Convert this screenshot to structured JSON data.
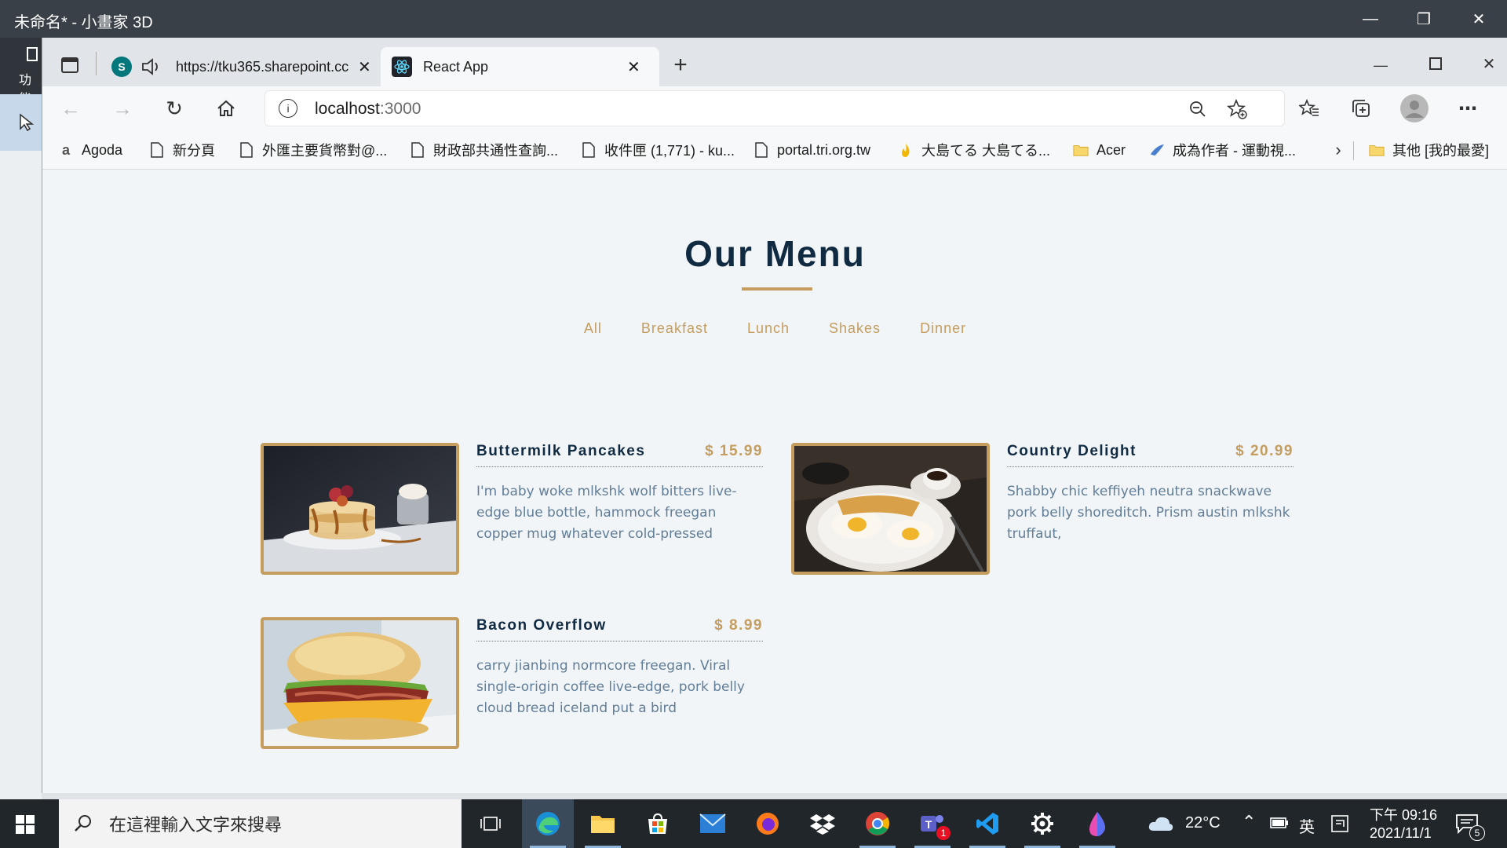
{
  "paint": {
    "title": "未命名* - 小畫家 3D",
    "side_label": "功能"
  },
  "browser": {
    "tabs": [
      {
        "label": "https://tku365.sharepoint.cc",
        "active": false
      },
      {
        "label": "React App",
        "active": true
      }
    ],
    "address": {
      "host": "localhost",
      "port": ":3000"
    },
    "bookmarks": [
      {
        "label": "Agoda",
        "icon": "agoda-icon"
      },
      {
        "label": "新分頁",
        "icon": "page-icon"
      },
      {
        "label": "外匯主要貨幣對@...",
        "icon": "page-icon"
      },
      {
        "label": "財政部共通性查詢...",
        "icon": "page-icon"
      },
      {
        "label": "收件匣 (1,771) - ku...",
        "icon": "page-icon"
      },
      {
        "label": "portal.tri.org.tw",
        "icon": "page-icon"
      },
      {
        "label": "大島てる 大島てる...",
        "icon": "flame-icon"
      },
      {
        "label": "Acer",
        "icon": "folder-icon"
      },
      {
        "label": "成為作者 - 運動視...",
        "icon": "bird-icon"
      },
      {
        "label": "其他 [我的最愛]",
        "icon": "folder-icon"
      }
    ]
  },
  "page": {
    "title": "Our Menu",
    "filters": [
      "All",
      "Breakfast",
      "Lunch",
      "Shakes",
      "Dinner"
    ],
    "items": [
      {
        "name": "Buttermilk Pancakes",
        "price": "$ 15.99",
        "desc": "I'm baby woke mlkshk wolf bitters live-edge blue bottle, hammock freegan copper mug whatever cold-pressed"
      },
      {
        "name": "Country Delight",
        "price": "$ 20.99",
        "desc": "Shabby chic keffiyeh neutra snackwave pork belly shoreditch. Prism austin mlkshk truffaut,"
      },
      {
        "name": "Bacon Overflow",
        "price": "$ 8.99",
        "desc": "carry jianbing normcore freegan. Viral single-origin coffee live-edge, pork belly cloud bread iceland put a bird"
      }
    ]
  },
  "taskbar": {
    "search_placeholder": "在這裡輸入文字來搜尋",
    "weather": "22°C",
    "ime": "英",
    "time": "下午 09:16",
    "date": "2021/11/1",
    "teams_badge": "1",
    "notif_count": "5"
  },
  "colors": {
    "accent": "#c59d5f",
    "title": "#102a42",
    "text": "#617d98"
  }
}
